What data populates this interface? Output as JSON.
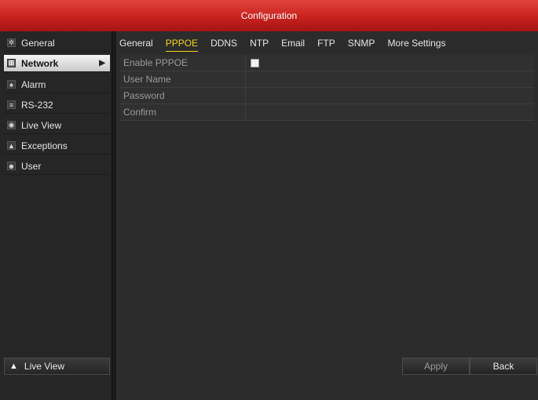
{
  "window": {
    "title": "Configuration"
  },
  "sidebar": {
    "items": [
      {
        "label": "General",
        "icon": "gear-icon"
      },
      {
        "label": "Network",
        "icon": "network-icon"
      },
      {
        "label": "Alarm",
        "icon": "alarm-icon"
      },
      {
        "label": "RS-232",
        "icon": "serial-port-icon"
      },
      {
        "label": "Live View",
        "icon": "eye-icon"
      },
      {
        "label": "Exceptions",
        "icon": "warning-icon"
      },
      {
        "label": "User",
        "icon": "users-icon"
      }
    ],
    "active_index": 1,
    "bottom_label": "Live View"
  },
  "tabs": [
    "General",
    "PPPOE",
    "DDNS",
    "NTP",
    "Email",
    "FTP",
    "SNMP",
    "More Settings"
  ],
  "active_tab": "PPPOE",
  "form": {
    "rows": [
      {
        "label": "Enable PPPOE",
        "type": "checkbox",
        "checked": false
      },
      {
        "label": "User Name",
        "type": "text",
        "value": ""
      },
      {
        "label": "Password",
        "type": "password",
        "value": ""
      },
      {
        "label": "Confirm",
        "type": "password",
        "value": ""
      }
    ]
  },
  "buttons": {
    "apply": "Apply",
    "back": "Back"
  },
  "colors": {
    "titlebar": "#c8211e",
    "active_tab": "#f5d31a"
  }
}
